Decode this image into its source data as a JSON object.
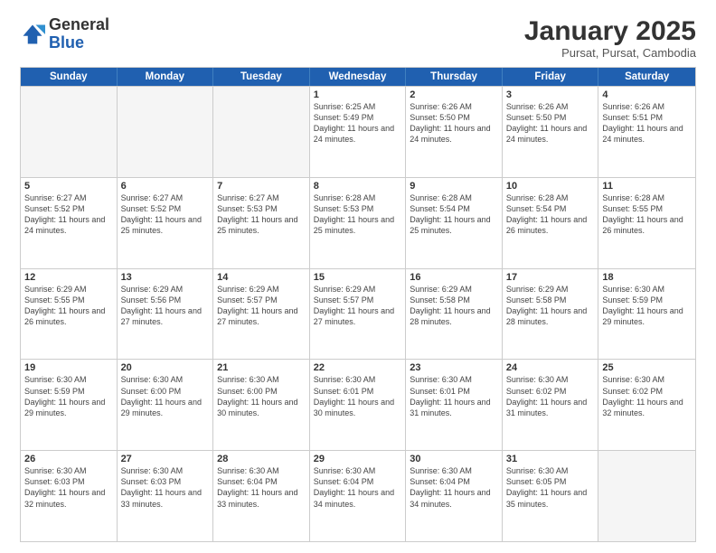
{
  "header": {
    "logo_general": "General",
    "logo_blue": "Blue",
    "month_title": "January 2025",
    "subtitle": "Pursat, Pursat, Cambodia"
  },
  "days_of_week": [
    "Sunday",
    "Monday",
    "Tuesday",
    "Wednesday",
    "Thursday",
    "Friday",
    "Saturday"
  ],
  "weeks": [
    [
      {
        "day": "",
        "info": ""
      },
      {
        "day": "",
        "info": ""
      },
      {
        "day": "",
        "info": ""
      },
      {
        "day": "1",
        "info": "Sunrise: 6:25 AM\nSunset: 5:49 PM\nDaylight: 11 hours and 24 minutes."
      },
      {
        "day": "2",
        "info": "Sunrise: 6:26 AM\nSunset: 5:50 PM\nDaylight: 11 hours and 24 minutes."
      },
      {
        "day": "3",
        "info": "Sunrise: 6:26 AM\nSunset: 5:50 PM\nDaylight: 11 hours and 24 minutes."
      },
      {
        "day": "4",
        "info": "Sunrise: 6:26 AM\nSunset: 5:51 PM\nDaylight: 11 hours and 24 minutes."
      }
    ],
    [
      {
        "day": "5",
        "info": "Sunrise: 6:27 AM\nSunset: 5:52 PM\nDaylight: 11 hours and 24 minutes."
      },
      {
        "day": "6",
        "info": "Sunrise: 6:27 AM\nSunset: 5:52 PM\nDaylight: 11 hours and 25 minutes."
      },
      {
        "day": "7",
        "info": "Sunrise: 6:27 AM\nSunset: 5:53 PM\nDaylight: 11 hours and 25 minutes."
      },
      {
        "day": "8",
        "info": "Sunrise: 6:28 AM\nSunset: 5:53 PM\nDaylight: 11 hours and 25 minutes."
      },
      {
        "day": "9",
        "info": "Sunrise: 6:28 AM\nSunset: 5:54 PM\nDaylight: 11 hours and 25 minutes."
      },
      {
        "day": "10",
        "info": "Sunrise: 6:28 AM\nSunset: 5:54 PM\nDaylight: 11 hours and 26 minutes."
      },
      {
        "day": "11",
        "info": "Sunrise: 6:28 AM\nSunset: 5:55 PM\nDaylight: 11 hours and 26 minutes."
      }
    ],
    [
      {
        "day": "12",
        "info": "Sunrise: 6:29 AM\nSunset: 5:55 PM\nDaylight: 11 hours and 26 minutes."
      },
      {
        "day": "13",
        "info": "Sunrise: 6:29 AM\nSunset: 5:56 PM\nDaylight: 11 hours and 27 minutes."
      },
      {
        "day": "14",
        "info": "Sunrise: 6:29 AM\nSunset: 5:57 PM\nDaylight: 11 hours and 27 minutes."
      },
      {
        "day": "15",
        "info": "Sunrise: 6:29 AM\nSunset: 5:57 PM\nDaylight: 11 hours and 27 minutes."
      },
      {
        "day": "16",
        "info": "Sunrise: 6:29 AM\nSunset: 5:58 PM\nDaylight: 11 hours and 28 minutes."
      },
      {
        "day": "17",
        "info": "Sunrise: 6:29 AM\nSunset: 5:58 PM\nDaylight: 11 hours and 28 minutes."
      },
      {
        "day": "18",
        "info": "Sunrise: 6:30 AM\nSunset: 5:59 PM\nDaylight: 11 hours and 29 minutes."
      }
    ],
    [
      {
        "day": "19",
        "info": "Sunrise: 6:30 AM\nSunset: 5:59 PM\nDaylight: 11 hours and 29 minutes."
      },
      {
        "day": "20",
        "info": "Sunrise: 6:30 AM\nSunset: 6:00 PM\nDaylight: 11 hours and 29 minutes."
      },
      {
        "day": "21",
        "info": "Sunrise: 6:30 AM\nSunset: 6:00 PM\nDaylight: 11 hours and 30 minutes."
      },
      {
        "day": "22",
        "info": "Sunrise: 6:30 AM\nSunset: 6:01 PM\nDaylight: 11 hours and 30 minutes."
      },
      {
        "day": "23",
        "info": "Sunrise: 6:30 AM\nSunset: 6:01 PM\nDaylight: 11 hours and 31 minutes."
      },
      {
        "day": "24",
        "info": "Sunrise: 6:30 AM\nSunset: 6:02 PM\nDaylight: 11 hours and 31 minutes."
      },
      {
        "day": "25",
        "info": "Sunrise: 6:30 AM\nSunset: 6:02 PM\nDaylight: 11 hours and 32 minutes."
      }
    ],
    [
      {
        "day": "26",
        "info": "Sunrise: 6:30 AM\nSunset: 6:03 PM\nDaylight: 11 hours and 32 minutes."
      },
      {
        "day": "27",
        "info": "Sunrise: 6:30 AM\nSunset: 6:03 PM\nDaylight: 11 hours and 33 minutes."
      },
      {
        "day": "28",
        "info": "Sunrise: 6:30 AM\nSunset: 6:04 PM\nDaylight: 11 hours and 33 minutes."
      },
      {
        "day": "29",
        "info": "Sunrise: 6:30 AM\nSunset: 6:04 PM\nDaylight: 11 hours and 34 minutes."
      },
      {
        "day": "30",
        "info": "Sunrise: 6:30 AM\nSunset: 6:04 PM\nDaylight: 11 hours and 34 minutes."
      },
      {
        "day": "31",
        "info": "Sunrise: 6:30 AM\nSunset: 6:05 PM\nDaylight: 11 hours and 35 minutes."
      },
      {
        "day": "",
        "info": ""
      }
    ]
  ]
}
